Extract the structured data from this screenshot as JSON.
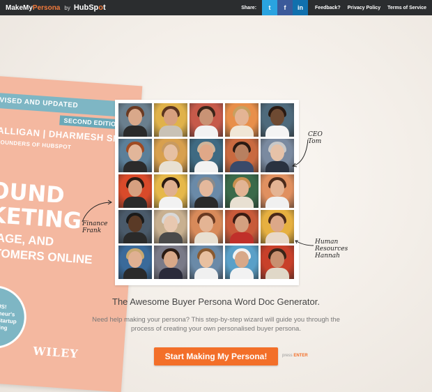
{
  "brand": {
    "part1": "MakeMy",
    "part2": "Persona",
    "by": "by",
    "hub_a": "Hub",
    "hub_b": "Sp",
    "hub_c": "t",
    "hub_o": "o"
  },
  "nav": {
    "share_label": "Share:",
    "twitter_icon": "t",
    "facebook_icon": "f",
    "linkedin_icon": "in",
    "links": [
      "Feedback?",
      "Privacy Policy",
      "Terms of Service"
    ]
  },
  "book": {
    "ribbon": "VISED AND UPDATED",
    "edition": "SECOND EDITION",
    "authors": "ALLIGAN | DHARMESH SHAH",
    "foreword": "FOUNDERS OF HUBSPOT",
    "title_line1": "OUND",
    "title_line2": "KETING",
    "title_line3": "GAGE, AND",
    "title_line4": "STOMERS ONLINE",
    "bonus_lines": [
      "BONUS!",
      "Entrepreneur's",
      "Guide to Startup",
      "Marketing"
    ],
    "publisher": "WILEY"
  },
  "annotations": {
    "ceo_line1": "CEO",
    "ceo_line2": "Tom",
    "finance_line1": "Finance",
    "finance_line2": "Frank",
    "hr_line1": "Human",
    "hr_line2": "Resources",
    "hr_line3": "Hannah"
  },
  "main": {
    "headline": "The Awesome Buyer Persona Word Doc Generator.",
    "description_line1": "Need help making your persona? This step-by-step wizard will guide you through the",
    "description_line2": "process of creating your own personalised buyer persona.",
    "cta_label": "Start Making My Persona!",
    "press_label": "press",
    "enter_label": "ENTER"
  },
  "colors": {
    "accent": "#f36f29",
    "topbar": "#2b2d2f",
    "twitter": "#2aa3e0",
    "facebook": "#3b5a9a",
    "linkedin": "#1170ad",
    "book": "#f4b8a0",
    "ribbon": "#7eb6c4"
  },
  "grid_photos": [
    {
      "bg": "#6a7f8e",
      "skin": "#d9a88a",
      "hair": "#6b3a22",
      "cloth": "#2a2a2a"
    },
    {
      "bg": "#e0b24a",
      "skin": "#d7a07e",
      "hair": "#5a3520",
      "cloth": "#c9c2b6"
    },
    {
      "bg": "#c65a4a",
      "skin": "#c99375",
      "hair": "#3a2418",
      "cloth": "#f2f2f2"
    },
    {
      "bg": "#e88f4a",
      "skin": "#e4b494",
      "hair": "#c8a060",
      "cloth": "#f0e6d6"
    },
    {
      "bg": "#4e6a7c",
      "skin": "#6e4a32",
      "hair": "#2a1a12",
      "cloth": "#f4f4f4"
    },
    {
      "bg": "#5b7f99",
      "skin": "#e2b69a",
      "hair": "#a04a22",
      "cloth": "#2b2b2b"
    },
    {
      "bg": "#d8a04e",
      "skin": "#e6c0a2",
      "hair": "#c89a60",
      "cloth": "#e8e0d2"
    },
    {
      "bg": "#3f6a82",
      "skin": "#e0a888",
      "hair": "#cfb49a",
      "cloth": "#f2f2f2"
    },
    {
      "bg": "#c96a40",
      "skin": "#b88060",
      "hair": "#2a1a12",
      "cloth": "#3a4a6a"
    },
    {
      "bg": "#7a8aa0",
      "skin": "#e6c2a8",
      "hair": "#c8c8c8",
      "cloth": "#2a3240"
    },
    {
      "bg": "#d94a2a",
      "skin": "#d6a080",
      "hair": "#2a1a12",
      "cloth": "#2a2a2a"
    },
    {
      "bg": "#e6b84a",
      "skin": "#e0b090",
      "hair": "#2a1a12",
      "cloth": "#f2f2f2"
    },
    {
      "bg": "#6a8aa8",
      "skin": "#e4b89c",
      "hair": "#8a8a8a",
      "cloth": "#2a2a2a"
    },
    {
      "bg": "#3a6a4a",
      "skin": "#e2b494",
      "hair": "#c89050",
      "cloth": "#e8e0d2"
    },
    {
      "bg": "#e09060",
      "skin": "#e4b494",
      "hair": "#4a2a1a",
      "cloth": "#f0f0f0"
    },
    {
      "bg": "#4a5a6a",
      "skin": "#5a3a26",
      "hair": "#1a1a1a",
      "cloth": "#2a2a2a"
    },
    {
      "bg": "#c8b090",
      "skin": "#e8c8b0",
      "hair": "#d8d8d8",
      "cloth": "#4a4a4a"
    },
    {
      "bg": "#d88a5a",
      "skin": "#e4b494",
      "hair": "#6a3a22",
      "cloth": "#e8e0d2"
    },
    {
      "bg": "#c85a3a",
      "skin": "#d4a080",
      "hair": "#3a1a12",
      "cloth": "#c0302a"
    },
    {
      "bg": "#e6b040",
      "skin": "#dca888",
      "hair": "#4a2a1a",
      "cloth": "#e8d8c8"
    },
    {
      "bg": "#3a6a9a",
      "skin": "#e0b092",
      "hair": "#c8a870",
      "cloth": "#2a2a2a"
    },
    {
      "bg": "#7a7a88",
      "skin": "#d8a888",
      "hair": "#2a1a12",
      "cloth": "#2a2a3a"
    },
    {
      "bg": "#6a8aa8",
      "skin": "#e8c0a0",
      "hair": "#8a5a30",
      "cloth": "#f0f0f0"
    },
    {
      "bg": "#5aa0c8",
      "skin": "#d8a888",
      "hair": "#f2f2f2",
      "cloth": "#f2f2f2"
    },
    {
      "bg": "#c8402a",
      "skin": "#c89070",
      "hair": "#3a2418",
      "cloth": "#e0d8c8"
    }
  ]
}
